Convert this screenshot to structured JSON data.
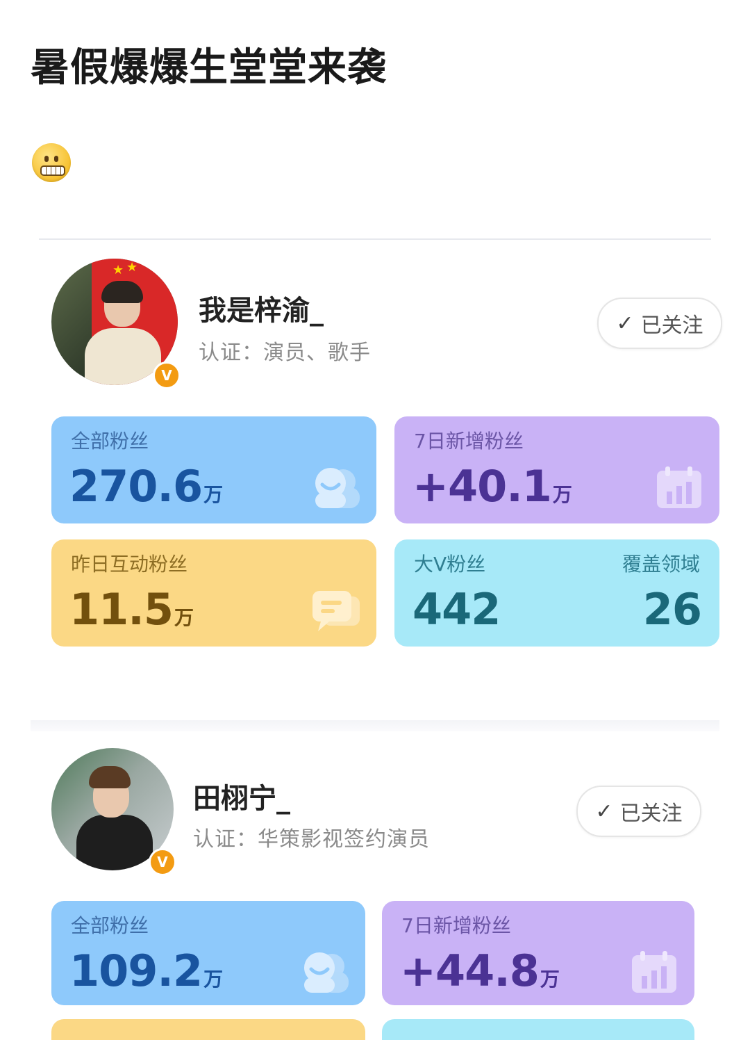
{
  "post": {
    "title": "暑假爆爆生堂堂来袭"
  },
  "emoji": {
    "icon": "grimacing-face-icon"
  },
  "profiles": [
    {
      "name": "我是梓渝_",
      "certification": "认证：演员、歌手",
      "follow_label": "已关注",
      "badge": "V",
      "stats": {
        "total_fans": {
          "label": "全部粉丝",
          "value": "270.6",
          "unit": "万"
        },
        "new_7d": {
          "label": "7日新增粉丝",
          "value": "+40.1",
          "unit": "万"
        },
        "interact_yesterday": {
          "label": "昨日互动粉丝",
          "value": "11.5",
          "unit": "万"
        },
        "bigv": {
          "label": "大V粉丝",
          "value": "442",
          "cover_label": "覆盖领域",
          "cover_value": "26"
        }
      }
    },
    {
      "name": "田栩宁_",
      "certification": "认证：华策影视签约演员",
      "follow_label": "已关注",
      "badge": "V",
      "stats": {
        "total_fans": {
          "label": "全部粉丝",
          "value": "109.2",
          "unit": "万"
        },
        "new_7d": {
          "label": "7日新增粉丝",
          "value": "+44.8",
          "unit": "万"
        }
      }
    }
  ]
}
